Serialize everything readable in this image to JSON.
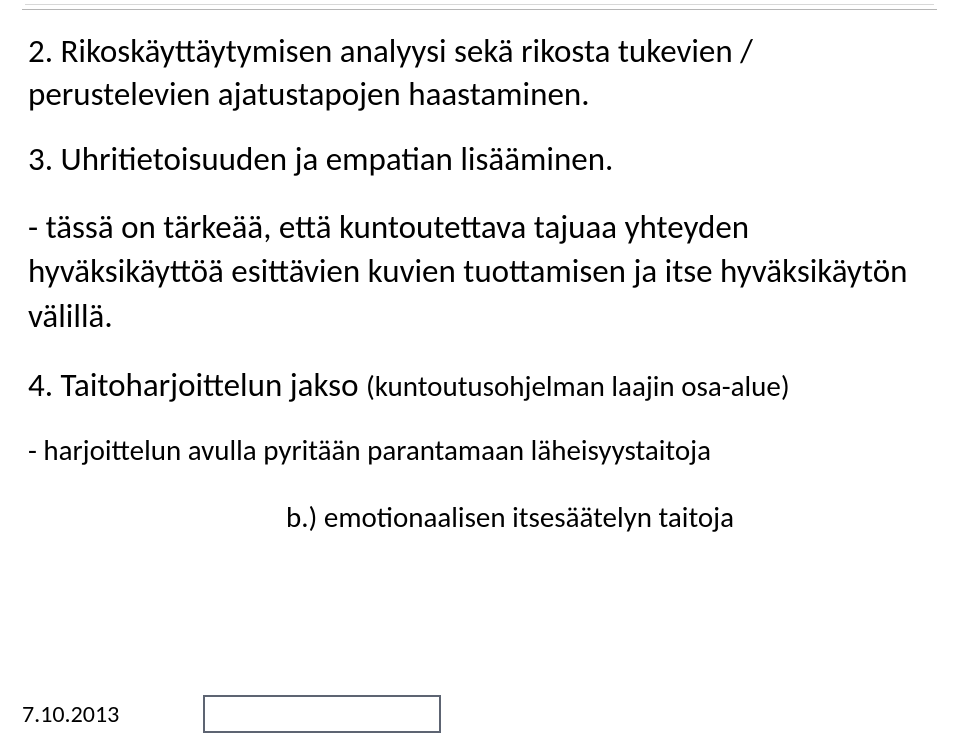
{
  "items": {
    "item2": "2. Rikoskäyttäytymisen analyysi sekä rikosta tukevien / perustelevien ajatustapojen haastaminen.",
    "item3": "3. Uhritietoisuuden ja empatian lisääminen.",
    "note3": "- tässä on tärkeää, että kuntoutettava tajuaa yhteyden hyväksikäyttöä esittävien kuvien tuottamisen ja itse hyväksikäytön välillä.",
    "item4_title": "4. Taitoharjoittelun jakso ",
    "item4_paren": "(kuntoutusohjelman laajin osa-alue)",
    "note4": "- harjoittelun avulla pyritään parantamaan läheisyystaitoja",
    "note4b": "b.) emotionaalisen itsesäätelyn taitoja"
  },
  "footer": {
    "date": "7.10.2013"
  }
}
